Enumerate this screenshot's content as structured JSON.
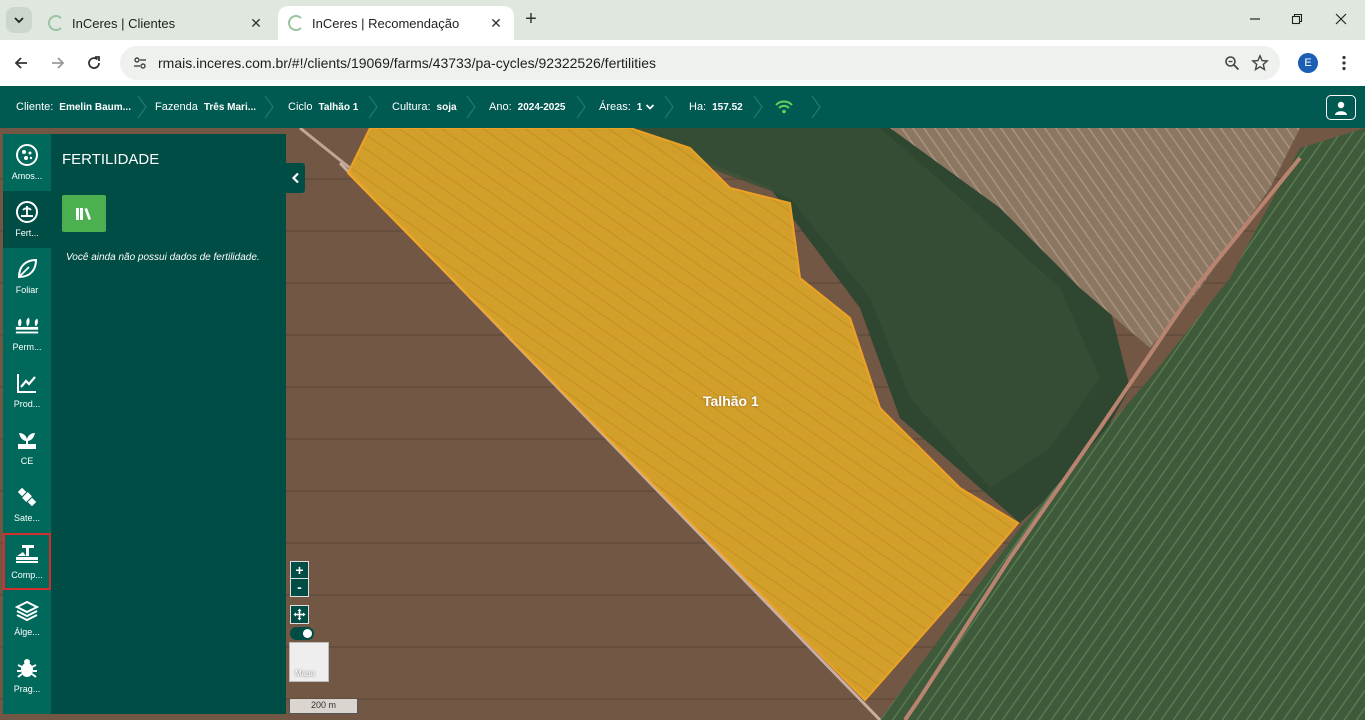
{
  "browser": {
    "tabs": [
      {
        "title": "InCeres | Clientes",
        "active": false
      },
      {
        "title": "InCeres | Recomendação",
        "active": true
      }
    ],
    "url": "rmais.inceres.com.br/#!/clients/19069/farms/43733/pa-cycles/92322526/fertilities",
    "profile_initial": "E"
  },
  "header": {
    "cliente_label": "Cliente:",
    "cliente_value": "Emelin Baum...",
    "fazenda_label": "Fazenda",
    "fazenda_value": "Três Mari...",
    "ciclo_label": "Ciclo",
    "ciclo_value": "Talhão 1",
    "cultura_label": "Cultura:",
    "cultura_value": "soja",
    "ano_label": "Ano:",
    "ano_value": "2024-2025",
    "areas_label": "Áreas:",
    "areas_value": "1",
    "ha_label": "Ha:",
    "ha_value": "157.52"
  },
  "rail": {
    "items": [
      {
        "label": "Amos...",
        "icon": "soil-sample-icon"
      },
      {
        "label": "Fert...",
        "icon": "fertility-icon",
        "active": true
      },
      {
        "label": "Foliar",
        "icon": "leaf-icon"
      },
      {
        "label": "Perm...",
        "icon": "permanent-crop-icon"
      },
      {
        "label": "Prod...",
        "icon": "productivity-chart-icon"
      },
      {
        "label": "CE",
        "icon": "sprout-icon"
      },
      {
        "label": "Sate...",
        "icon": "satellite-icon"
      },
      {
        "label": "Comp...",
        "icon": "compaction-icon",
        "highlighted": true
      },
      {
        "label": "Álge...",
        "icon": "layers-icon"
      },
      {
        "label": "Prag...",
        "icon": "bug-icon"
      }
    ]
  },
  "panel": {
    "title": "FERTILIDADE",
    "empty_message": "Você ainda não possui dados de fertilidade."
  },
  "map": {
    "field_label": "Talhão 1",
    "zoom_in": "+",
    "zoom_out": "-",
    "basemap_label": "Mapa",
    "scale_label": "200 m"
  },
  "colors": {
    "primary": "#005a52",
    "panel": "#004d45",
    "rail": "#00695c",
    "field_fill": "#d9a32a",
    "field_outline": "#f5a623",
    "button_green": "#4caf50",
    "highlight": "#d32f2f"
  }
}
